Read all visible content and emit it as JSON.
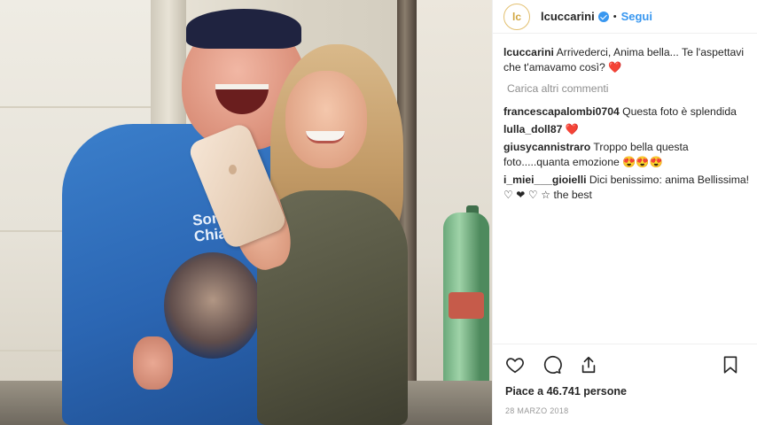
{
  "post": {
    "photo_alt": "",
    "username": "lcuccarini",
    "avatar_text": "lc",
    "follow_label": "Segui",
    "separator": "•"
  },
  "caption": {
    "user": "lcuccarini",
    "text": "Arrivederci, Anima bella... Te l'aspettavi che t'amavamo così?",
    "emoji": "❤️"
  },
  "load_more_label": "Carica altri commenti",
  "comments": [
    {
      "user": "francescapalombi0704",
      "text": "Questa foto è splendida",
      "emoji": ""
    },
    {
      "user": "lulla_doll87",
      "text": "",
      "emoji": "❤️"
    },
    {
      "user": "giusycannistraro",
      "text": "Troppo bella questa foto.....quanta emozione",
      "emoji": "😍😍😍"
    },
    {
      "user": "i_miei___gioielli",
      "text": "Dici benissimo: anima Bellissima! ♡ ❤ ♡ ☆ the best",
      "emoji": ""
    }
  ],
  "likes": {
    "prefix": "Piace a",
    "count": "46.741",
    "suffix": "persone"
  },
  "date": "28 MARZO 2018",
  "photo_shirt_text": [
    "Sono",
    "Chiara"
  ],
  "icons": [
    "heart-outline-icon",
    "comment-icon",
    "share-icon",
    "bookmark-icon",
    "verified-badge-icon"
  ]
}
